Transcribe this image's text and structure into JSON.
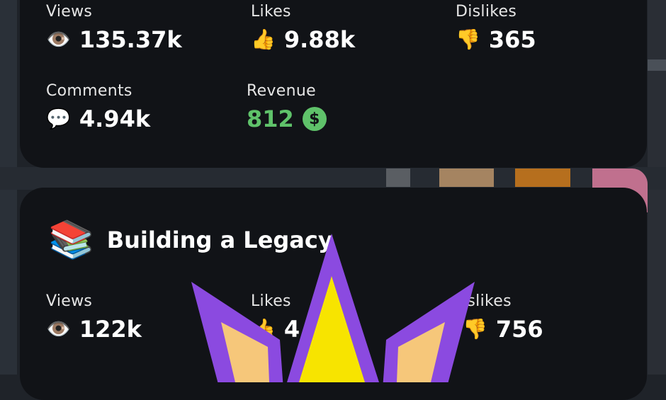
{
  "card1": {
    "views_label": "Views",
    "views_value": "135.37k",
    "likes_label": "Likes",
    "likes_value": "9.88k",
    "dislikes_label": "Dislikes",
    "dislikes_value": "365",
    "comments_label": "Comments",
    "comments_value": "4.94k",
    "revenue_label": "Revenue",
    "revenue_value": "812",
    "revenue_currency_icon": "$"
  },
  "card2": {
    "title": "Building a Legacy",
    "views_label": "Views",
    "views_value": "122k",
    "likes_label": "Likes",
    "likes_value_visible": "4",
    "dislikes_label_visible": "islikes",
    "dislikes_value": "756"
  },
  "icons": {
    "views": "👁️",
    "likes": "👍",
    "dislikes": "👎",
    "comments": "💬",
    "books": "📚"
  },
  "colors": {
    "background": "#1f2329",
    "card": "#111317",
    "revenue": "#5fc26a",
    "overlay_purple": "#8b4ae0",
    "overlay_yellow": "#f7e400",
    "overlay_cream": "#f6c77a"
  }
}
